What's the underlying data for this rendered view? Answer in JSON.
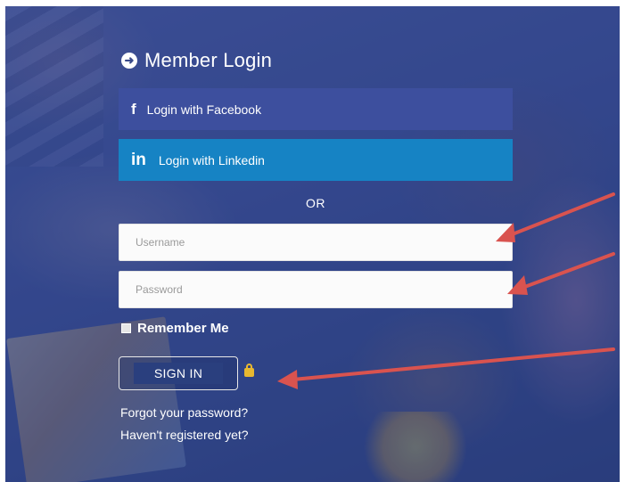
{
  "login": {
    "title": "Member Login",
    "title_icon": "arrow-circle-right-icon",
    "facebook_label": "Login with Facebook",
    "facebook_icon": "f",
    "linkedin_label": "Login with Linkedin",
    "linkedin_icon": "in",
    "or_text": "OR",
    "username_placeholder": "Username",
    "username_value": "",
    "password_placeholder": "Password",
    "password_value": "",
    "remember_label": "Remember Me",
    "remember_checked": false,
    "signin_label": "SIGN IN",
    "forgot_link": "Forgot your password?",
    "register_link": "Haven't registered yet?"
  },
  "colors": {
    "facebook_bg": "#3d4f9e",
    "linkedin_bg": "#1683c4",
    "overlay": "#2c3c70",
    "annotation_arrow": "#d9534f",
    "lock": "#e8b830"
  },
  "annotations": {
    "arrow_count": 3,
    "arrow_targets": [
      "username-field",
      "password-field",
      "lock-icon"
    ]
  }
}
